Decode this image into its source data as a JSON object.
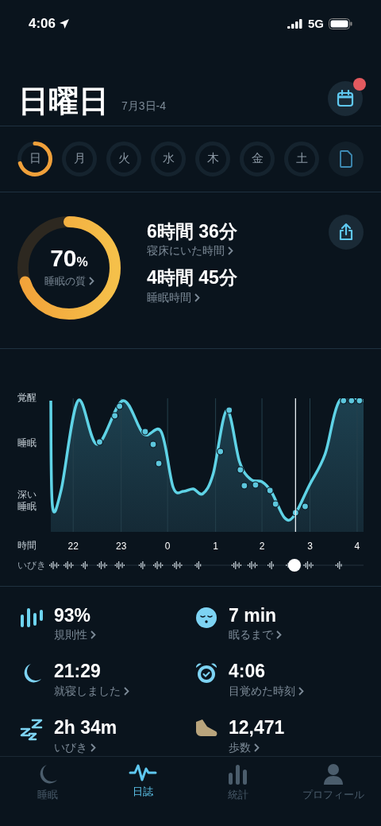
{
  "status_bar": {
    "time": "4:06",
    "network": "5G"
  },
  "header": {
    "title": "日曜日",
    "date": "7月3日-4",
    "calendar_badge": true
  },
  "days": [
    {
      "label": "日",
      "scored": true
    },
    {
      "label": "月",
      "scored": false
    },
    {
      "label": "火",
      "scored": false
    },
    {
      "label": "水",
      "scored": false
    },
    {
      "label": "木",
      "scored": false
    },
    {
      "label": "金",
      "scored": false
    },
    {
      "label": "土",
      "scored": false
    }
  ],
  "summary": {
    "quality": {
      "value": "70",
      "unit": "%",
      "label": "睡眠の質"
    },
    "stats": [
      {
        "value": "6時間 36分",
        "label": "寝床にいた時間"
      },
      {
        "value": "4時間 45分",
        "label": "睡眠時間"
      }
    ]
  },
  "hypnogram": {
    "stages": [
      "覚醒",
      "睡眠",
      "深い睡眠"
    ],
    "time_label": "時間",
    "hours": [
      "22",
      "23",
      "0",
      "1",
      "2",
      "3",
      "4"
    ],
    "snore_label": "いびき"
  },
  "metrics": [
    {
      "kind": "regularity",
      "value": "93%",
      "label": "規則性"
    },
    {
      "kind": "latency",
      "value": "7 min",
      "label": "眠るまで"
    },
    {
      "kind": "bedtime",
      "value": "21:29",
      "label": "就寝しました"
    },
    {
      "kind": "wake",
      "value": "4:06",
      "label": "目覚めた時刻"
    },
    {
      "kind": "snore",
      "value": "2h 34m",
      "label": "いびき"
    },
    {
      "kind": "steps",
      "value": "12,471",
      "label": "歩数"
    }
  ],
  "tabs": [
    {
      "kind": "sleep",
      "label": "睡眠",
      "selected": false
    },
    {
      "kind": "journal",
      "label": "日誌",
      "selected": true
    },
    {
      "kind": "stats",
      "label": "統計",
      "selected": false
    },
    {
      "kind": "profile",
      "label": "プロフィール",
      "selected": false
    }
  ]
}
